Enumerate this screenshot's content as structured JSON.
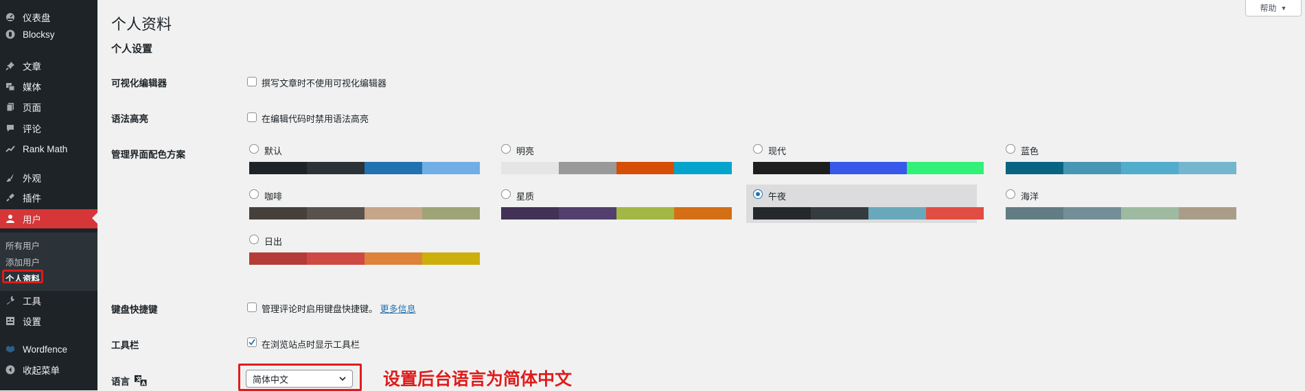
{
  "sidebar": {
    "items": [
      {
        "label": "仪表盘",
        "icon": "dashboard-icon"
      },
      {
        "label": "Blocksy",
        "icon": "blocksy-icon"
      },
      {
        "label": "文章",
        "icon": "pin-icon"
      },
      {
        "label": "媒体",
        "icon": "media-icon"
      },
      {
        "label": "页面",
        "icon": "page-icon"
      },
      {
        "label": "评论",
        "icon": "comment-icon"
      },
      {
        "label": "Rank Math",
        "icon": "rank-math-icon"
      },
      {
        "label": "外观",
        "icon": "appearance-icon"
      },
      {
        "label": "插件",
        "icon": "plugin-icon"
      },
      {
        "label": "用户",
        "icon": "user-icon"
      },
      {
        "label": "工具",
        "icon": "wrench-icon"
      },
      {
        "label": "设置",
        "icon": "settings-icon"
      },
      {
        "label": "Wordfence",
        "icon": "wordfence-icon"
      },
      {
        "label": "收起菜单",
        "icon": "collapse-icon"
      }
    ],
    "submenu": [
      "所有用户",
      "添加用户",
      "个人资料"
    ]
  },
  "help": {
    "label": "帮助"
  },
  "page": {
    "title": "个人资料",
    "section": "个人设置"
  },
  "rows": {
    "visual_editor": {
      "label": "可视化编辑器",
      "checkbox": "撰写文章时不使用可视化编辑器",
      "checked": false
    },
    "syntax": {
      "label": "语法高亮",
      "checkbox": "在编辑代码时禁用语法高亮",
      "checked": false
    },
    "color_scheme": {
      "label": "管理界面配色方案"
    },
    "keyboard": {
      "label": "键盘快捷键",
      "checkbox": "管理评论时启用键盘快捷键。",
      "link": "更多信息",
      "checked": false
    },
    "toolbar": {
      "label": "工具栏",
      "checkbox": "在浏览站点时显示工具栏",
      "checked": true
    },
    "language": {
      "label": "语言",
      "selected": "简体中文",
      "icon": "translate-icon"
    }
  },
  "color_schemes": [
    {
      "name": "默认",
      "selected": false,
      "colors": [
        "#1d2327",
        "#2c3338",
        "#2271b1",
        "#72aee6"
      ]
    },
    {
      "name": "明亮",
      "selected": false,
      "colors": [
        "#e5e5e5",
        "#999999",
        "#d64e07",
        "#04a4cc"
      ]
    },
    {
      "name": "现代",
      "selected": false,
      "colors": [
        "#1e1e1e",
        "#3858e9",
        "#33f078"
      ]
    },
    {
      "name": "蓝色",
      "selected": false,
      "colors": [
        "#096484",
        "#4796b3",
        "#52accc",
        "#74b6ce"
      ]
    },
    {
      "name": "咖啡",
      "selected": false,
      "colors": [
        "#46403c",
        "#59524c",
        "#c7a589",
        "#9ea476"
      ]
    },
    {
      "name": "星质",
      "selected": false,
      "colors": [
        "#413256",
        "#523f6d",
        "#a3b745",
        "#d46f15"
      ]
    },
    {
      "name": "午夜",
      "selected": true,
      "colors": [
        "#25282b",
        "#363b3f",
        "#69a8bb",
        "#e14d43"
      ]
    },
    {
      "name": "海洋",
      "selected": false,
      "colors": [
        "#627c83",
        "#738e96",
        "#9ebaa0",
        "#aa9d88"
      ]
    },
    {
      "name": "日出",
      "selected": false,
      "colors": [
        "#b43c38",
        "#cf4944",
        "#dd823b",
        "#ccaf0b"
      ]
    }
  ],
  "annotation": "设置后台语言为简体中文"
}
